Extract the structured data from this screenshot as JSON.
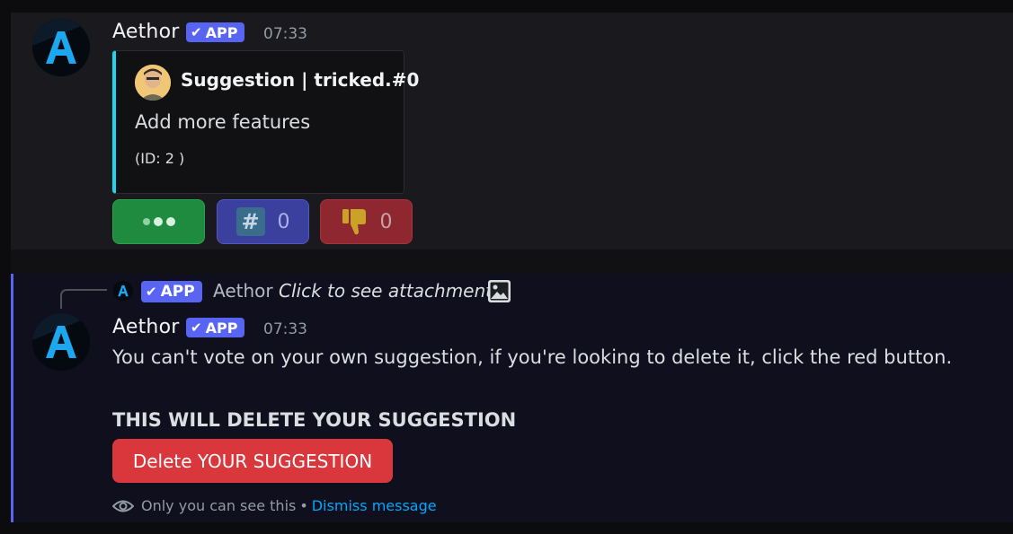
{
  "message1": {
    "username": "Aethor",
    "badge": "APP",
    "badge_check": "✔",
    "timestamp": "07:33",
    "embed": {
      "accent_color": "#22d3ee",
      "title": "Suggestion | tricked.#0",
      "description": "Add more features",
      "id_text": "(ID: 2 )"
    },
    "buttons": {
      "options_icon": "three-dots-icon",
      "upvote_icon": "hash-icon",
      "upvote_count": "0",
      "downvote_icon": "thumbs-down-icon",
      "downvote_count": "0"
    }
  },
  "message2": {
    "reply": {
      "badge": "APP",
      "badge_check": "✔",
      "username": "Aethor",
      "text": "Click to see attachment",
      "icon": "image-icon"
    },
    "username": "Aethor",
    "badge": "APP",
    "badge_check": "✔",
    "timestamp": "07:33",
    "text": "You can't vote on your own suggestion, if you're looking to delete it, click the red button.",
    "warning": "THIS WILL DELETE YOUR SUGGESTION",
    "delete_button": "Delete YOUR SUGGESTION",
    "ephemeral": {
      "icon": "eye-icon",
      "text": "Only you can see this",
      "separator": "•",
      "dismiss": "Dismiss message"
    }
  },
  "colors": {
    "brand": "#5865f2",
    "danger": "#da373c",
    "success": "#1f8b3e",
    "link": "#00a8fc"
  }
}
